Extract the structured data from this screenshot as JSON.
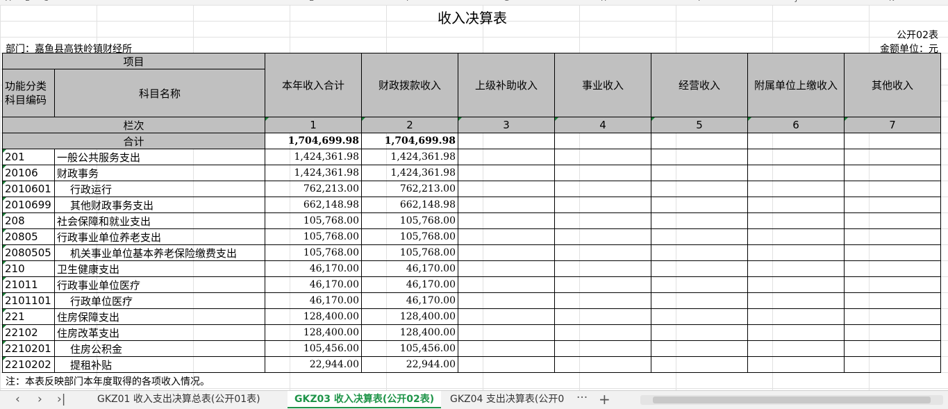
{
  "column_letters": [
    "A",
    "B",
    "C",
    "E",
    "F",
    "G",
    "H",
    "I",
    "J",
    "K"
  ],
  "title": "收入决算表",
  "form_code": "公开02表",
  "department": "部门：嘉鱼县高铁岭镇财经所",
  "unit": "金额单位：元",
  "headers": {
    "item": "项目",
    "code": "功能分类科目编码",
    "name": "科目名称",
    "columns": [
      "本年收入合计",
      "财政拨款收入",
      "上级补助收入",
      "事业收入",
      "经营收入",
      "附属单位上缴收入",
      "其他收入"
    ],
    "row_label": "栏次",
    "column_numbers": [
      "1",
      "2",
      "3",
      "4",
      "5",
      "6",
      "7"
    ]
  },
  "total": {
    "label": "合计",
    "values": [
      "1,704,699.98",
      "1,704,699.98"
    ]
  },
  "rows": [
    {
      "code": "201",
      "name": "一般公共服务支出",
      "total": "1,424,361.98",
      "fiscal": "1,424,361.98"
    },
    {
      "code": "20106",
      "name": "财政事务",
      "total": "1,424,361.98",
      "fiscal": "1,424,361.98"
    },
    {
      "code": "2010601",
      "name": "行政运行",
      "total": "762,213.00",
      "fiscal": "762,213.00"
    },
    {
      "code": "2010699",
      "name": "其他财政事务支出",
      "total": "662,148.98",
      "fiscal": "662,148.98"
    },
    {
      "code": "208",
      "name": "社会保障和就业支出",
      "total": "105,768.00",
      "fiscal": "105,768.00"
    },
    {
      "code": "20805",
      "name": "行政事业单位养老支出",
      "total": "105,768.00",
      "fiscal": "105,768.00"
    },
    {
      "code": "2080505",
      "name": "机关事业单位基本养老保险缴费支出",
      "total": "105,768.00",
      "fiscal": "105,768.00"
    },
    {
      "code": "210",
      "name": "卫生健康支出",
      "total": "46,170.00",
      "fiscal": "46,170.00"
    },
    {
      "code": "21011",
      "name": "行政事业单位医疗",
      "total": "46,170.00",
      "fiscal": "46,170.00"
    },
    {
      "code": "2101101",
      "name": "行政单位医疗",
      "total": "46,170.00",
      "fiscal": "46,170.00"
    },
    {
      "code": "221",
      "name": "住房保障支出",
      "total": "128,400.00",
      "fiscal": "128,400.00"
    },
    {
      "code": "22102",
      "name": "住房改革支出",
      "total": "128,400.00",
      "fiscal": "128,400.00"
    },
    {
      "code": "2210201",
      "name": "住房公积金",
      "total": "105,456.00",
      "fiscal": "105,456.00"
    },
    {
      "code": "2210202",
      "name": "提租补贴",
      "total": "22,944.00",
      "fiscal": "22,944.00"
    }
  ],
  "note": "注：本表反映部门本年度取得的各项收入情况。",
  "tabs": [
    {
      "label": "GKZ01 收入支出决算总表(公开01表)",
      "active": false
    },
    {
      "label": "GKZ03 收入决算表(公开02表)",
      "active": true
    },
    {
      "label": "GKZ04 支出决算表(公开0",
      "active": false
    }
  ],
  "nav": {
    "prev": "‹",
    "next": "›",
    "last": "›|",
    "more": "···",
    "add": "+"
  }
}
